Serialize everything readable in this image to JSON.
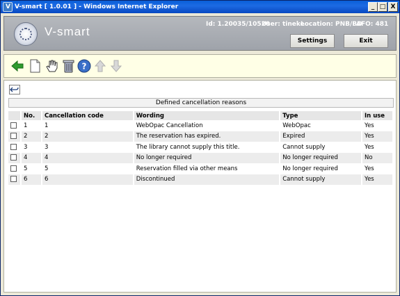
{
  "window": {
    "title": "V-smart [ 1.0.01 ] - Windows Internet Explorer",
    "minimize_label": "_",
    "maximize_label": "□",
    "close_label": "X"
  },
  "header": {
    "brand": "V-smart",
    "id_text": "Id: 1.20035/10520",
    "user_text": "User: tineke",
    "location_text": "Location: PNB/BD",
    "afo_text": "AFO: 481",
    "settings_label": "Settings",
    "exit_label": "Exit"
  },
  "toolbar": {
    "icons": [
      "back-arrow-icon",
      "new-document-icon",
      "select-hand-icon",
      "delete-trash-icon",
      "help-icon",
      "up-arrow-icon",
      "down-arrow-icon"
    ]
  },
  "content": {
    "undo_icon": "undo-icon",
    "caption": "Defined cancellation reasons",
    "columns": [
      "",
      "No.",
      "Cancellation code",
      "Wording",
      "Type",
      "In use"
    ],
    "rows": [
      {
        "no": "1",
        "code": "1",
        "wording": "WebOpac Cancellation",
        "type": "WebOpac",
        "in_use": "Yes"
      },
      {
        "no": "2",
        "code": "2",
        "wording": "The reservation has expired.",
        "type": "Expired",
        "in_use": "Yes"
      },
      {
        "no": "3",
        "code": "3",
        "wording": "The library cannot supply this title.",
        "type": "Cannot supply",
        "in_use": "Yes"
      },
      {
        "no": "4",
        "code": "4",
        "wording": "No longer required",
        "type": "No longer required",
        "in_use": "No"
      },
      {
        "no": "5",
        "code": "5",
        "wording": "Reservation filled via other means",
        "type": "No longer required",
        "in_use": "Yes"
      },
      {
        "no": "6",
        "code": "6",
        "wording": "Discontinued",
        "type": "Cannot supply",
        "in_use": "Yes"
      }
    ]
  },
  "colors": {
    "titlebar": "#0a5fd8",
    "header_gray": "#a7abb1",
    "toolbar_bg": "#ffffe6",
    "row_alt": "#ececec",
    "back_arrow": "#2e9b2e"
  }
}
